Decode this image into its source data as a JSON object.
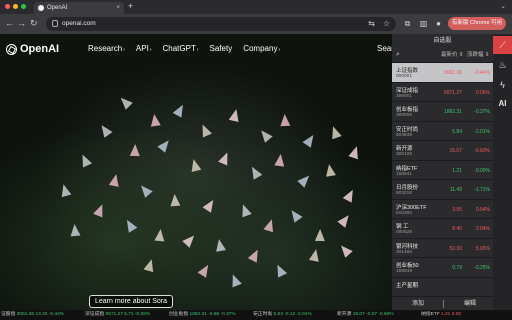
{
  "browser": {
    "tab_title": "OpenAI",
    "tab_close": "×",
    "new_tab": "+",
    "url": "openai.com",
    "guest_label": "有新版 Chrome 可用",
    "colors": {
      "red": "#ff5f57",
      "yellow": "#febc2e",
      "green": "#28c840"
    }
  },
  "site": {
    "logo_text": "OpenAI",
    "nav": [
      {
        "label": "Research",
        "caret": "›"
      },
      {
        "label": "API",
        "caret": "›"
      },
      {
        "label": "ChatGPT",
        "caret": "›"
      },
      {
        "label": "Safety",
        "caret": ""
      },
      {
        "label": "Company",
        "caret": "›"
      }
    ],
    "search_partial": "Sear",
    "cta": "Learn more about Sora"
  },
  "panel": {
    "title": "自选股",
    "col_price": "最新价 ⇕",
    "col_change": "涨跌幅 ⇕",
    "rows": [
      {
        "name": "上证指数",
        "code": "000001",
        "price": "3061.36",
        "change": "-0.44%",
        "dir": "up"
      },
      {
        "name": "深证成指",
        "code": "399001",
        "price": "9571.27",
        "change": "0.06%",
        "dir": "up"
      },
      {
        "name": "创业板指",
        "code": "399006",
        "price": "1862.31",
        "change": "-0.37%",
        "dir": "dn"
      },
      {
        "name": "安正时尚",
        "code": "603839",
        "price": "5.84",
        "change": "-2.01%",
        "dir": "dn"
      },
      {
        "name": "新开源",
        "code": "300109",
        "price": "15.07",
        "change": "-0.60%",
        "dir": "up"
      },
      {
        "name": "纳指ETF",
        "code": "159941",
        "price": "1.21",
        "change": "-0.00%",
        "dir": "dn"
      },
      {
        "name": "日月股份",
        "code": "603218",
        "price": "11.49",
        "change": "-1.71%",
        "dir": "dn"
      },
      {
        "name": "沪深300ETF",
        "code": "510300",
        "price": "3.55",
        "change": "0.54%",
        "dir": "up"
      },
      {
        "name": "钢 工",
        "code": "000628",
        "price": "8.40",
        "change": "3.04%",
        "dir": "up"
      },
      {
        "name": "银河科技",
        "code": "301486",
        "price": "52.30",
        "change": "5.65%",
        "dir": "up"
      },
      {
        "name": "创业板50",
        "code": "159949",
        "price": "0.79",
        "change": "-0.25%",
        "dir": "dn"
      },
      {
        "name": "主产星期",
        "code": "",
        "price": "",
        "change": "",
        "dir": "up"
      }
    ],
    "add_label": "添加",
    "edit_label": "编辑"
  },
  "rail": [
    "chart-icon",
    "fire-icon",
    "bolt-icon",
    "ai-icon"
  ],
  "rail_ai": "AI",
  "ticker": [
    {
      "name": "证股指",
      "price": "3061.36",
      "d1": "13.33",
      "d2": "-0.44%"
    },
    {
      "name": "深证成指",
      "price": "9571.27",
      "d1": "5.71",
      "d2": "-0.06%"
    },
    {
      "name": "创业板指",
      "price": "1862.31",
      "d1": "-6.86",
      "d2": "-0.37%"
    },
    {
      "name": "安正时尚",
      "price": "5.84",
      "d1": "-0.12",
      "d2": "-2.01%"
    },
    {
      "name": "新开源",
      "price": "15.07",
      "d1": "-0.07",
      "d2": "-0.60%"
    },
    {
      "name": "纳指ETF",
      "price": "1.21",
      "d1": "0.00",
      "d2": ""
    }
  ]
}
